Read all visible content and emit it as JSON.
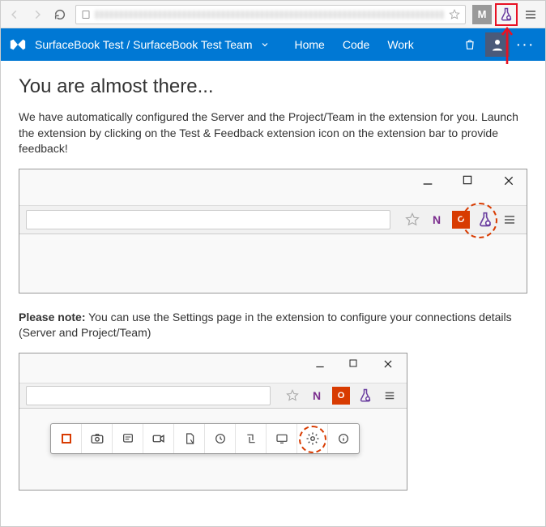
{
  "browser": {
    "ext_m": "M"
  },
  "header": {
    "title": "SurfaceBook Test / SurfaceBook Test Team",
    "nav": {
      "home": "Home",
      "code": "Code",
      "work": "Work"
    },
    "more": "···"
  },
  "content": {
    "heading": "You are almost there...",
    "paragraph": "We have automatically configured the Server and the Project/Team in the extension for you. Launch the extension by clicking on the Test & Feedback extension icon on the extension bar to provide feedback!",
    "note_label": "Please note:",
    "note_text": " You can use the Settings page in the extension to configure your connections details (Server and Project/Team)"
  },
  "illus": {
    "office": "O",
    "onenote": "N"
  }
}
